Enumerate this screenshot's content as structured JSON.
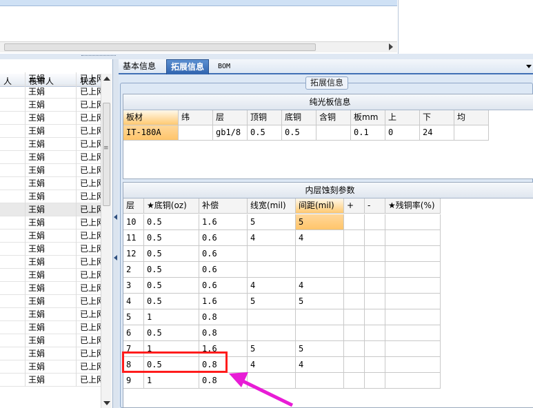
{
  "top_grid": {
    "selected_row_text": ""
  },
  "tabs": [
    {
      "label": "基本信息"
    },
    {
      "label": "拓展信息"
    },
    {
      "label": "BOM"
    }
  ],
  "group_title": "拓展信息",
  "left_table": {
    "headers": [
      "人",
      "核审人",
      "状态"
    ],
    "rows": [
      {
        "reviewer": "王娟",
        "status": "已上网"
      },
      {
        "reviewer": "王娟",
        "status": "已上网"
      },
      {
        "reviewer": "王娟",
        "status": "已上网"
      },
      {
        "reviewer": "王娟",
        "status": "已上网"
      },
      {
        "reviewer": "王娟",
        "status": "已上网"
      },
      {
        "reviewer": "王娟",
        "status": "已上网"
      },
      {
        "reviewer": "王娟",
        "status": "已上网"
      },
      {
        "reviewer": "王娟",
        "status": "已上网"
      },
      {
        "reviewer": "王娟",
        "status": "已上网"
      },
      {
        "reviewer": "王娟",
        "status": "已上网"
      },
      {
        "reviewer": "王娟",
        "status": "已上网"
      },
      {
        "reviewer": "王娟",
        "status": "已上网"
      },
      {
        "reviewer": "王娟",
        "status": "已上网"
      },
      {
        "reviewer": "王娟",
        "status": "已上网"
      },
      {
        "reviewer": "王娟",
        "status": "已上网"
      },
      {
        "reviewer": "王娟",
        "status": "已上网"
      },
      {
        "reviewer": "王娟",
        "status": "已上网"
      },
      {
        "reviewer": "王娟",
        "status": "已上网"
      },
      {
        "reviewer": "王娟",
        "status": "已上网"
      },
      {
        "reviewer": "王娟",
        "status": "已上网"
      },
      {
        "reviewer": "王娟",
        "status": "已上网"
      },
      {
        "reviewer": "王娟",
        "status": "已上网"
      },
      {
        "reviewer": "王娟",
        "status": "已上网"
      },
      {
        "reviewer": "王娟",
        "status": "已上网"
      }
    ]
  },
  "plain_board": {
    "title": "纯光板信息",
    "headers": [
      "板材",
      "纬",
      "层",
      "顶铜",
      "底铜",
      "含铜",
      "板mm",
      "上",
      "下",
      "均"
    ],
    "row": [
      "IT-180A",
      "",
      "gb1/8",
      "0.5",
      "0.5",
      "",
      "0.1",
      "0",
      "24",
      ""
    ]
  },
  "inner_etch": {
    "title": "内层蚀刻参数",
    "headers": [
      "层",
      "★底铜(oz)",
      "补偿",
      "线宽(mil)",
      "间距(mil)",
      "+",
      "-",
      "★残铜率(%)"
    ],
    "rows": [
      [
        "10",
        "0.5",
        "1.6",
        "5",
        "5",
        "",
        "",
        ""
      ],
      [
        "11",
        "0.5",
        "0.6",
        "4",
        "4",
        "",
        "",
        ""
      ],
      [
        "12",
        "0.5",
        "0.6",
        "",
        "",
        "",
        "",
        ""
      ],
      [
        "2",
        "0.5",
        "0.6",
        "",
        "",
        "",
        "",
        ""
      ],
      [
        "3",
        "0.5",
        "0.6",
        "4",
        "4",
        "",
        "",
        ""
      ],
      [
        "4",
        "0.5",
        "1.6",
        "5",
        "5",
        "",
        "",
        ""
      ],
      [
        "5",
        "1",
        "0.8",
        "",
        "",
        "",
        "",
        ""
      ],
      [
        "6",
        "0.5",
        "0.8",
        "",
        "",
        "",
        "",
        ""
      ],
      [
        "7",
        "1",
        "1.6",
        "5",
        "5",
        "",
        "",
        ""
      ],
      [
        "8",
        "0.5",
        "0.8",
        "4",
        "4",
        "",
        "",
        ""
      ],
      [
        "9",
        "1",
        "0.8",
        "",
        "",
        "",
        "",
        ""
      ]
    ]
  },
  "colors": {
    "highlight": "#ffc56a",
    "red_box": "#ff1c1c",
    "arrow": "#e81cd6",
    "tab_active": "#2f63ae"
  }
}
